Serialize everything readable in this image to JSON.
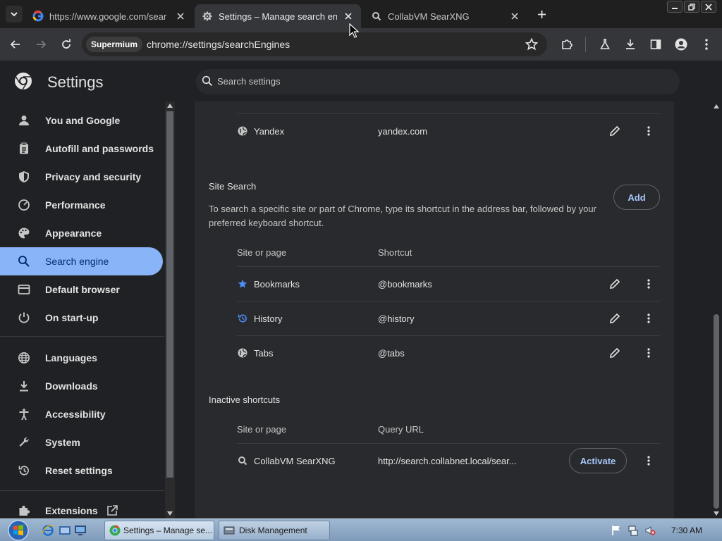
{
  "colors": {
    "accent": "#8ab4f8",
    "link": "#a8c7fa",
    "card": "#292a2d",
    "background": "#202124"
  },
  "tabs": [
    {
      "title": "https://www.google.com/sear",
      "icon": "google-icon",
      "active": false
    },
    {
      "title": "Settings – Manage search engi",
      "icon": "gear-icon",
      "active": true
    },
    {
      "title": "CollabVM SearXNG",
      "icon": "searxng-icon",
      "active": false
    }
  ],
  "toolbar": {
    "profile_chip": "Supermium",
    "url": "chrome://settings/searchEngines"
  },
  "header": {
    "title": "Settings",
    "search_placeholder": "Search settings"
  },
  "sidebar": {
    "items": [
      {
        "label": "You and Google",
        "icon": "person-icon"
      },
      {
        "label": "Autofill and passwords",
        "icon": "clipboard-icon"
      },
      {
        "label": "Privacy and security",
        "icon": "shield-icon"
      },
      {
        "label": "Performance",
        "icon": "gauge-icon"
      },
      {
        "label": "Appearance",
        "icon": "palette-icon"
      },
      {
        "label": "Search engine",
        "icon": "search-icon",
        "selected": true
      },
      {
        "label": "Default browser",
        "icon": "browser-icon"
      },
      {
        "label": "On start-up",
        "icon": "power-icon"
      },
      {
        "label": "Languages",
        "icon": "globe-icon"
      },
      {
        "label": "Downloads",
        "icon": "download-icon"
      },
      {
        "label": "Accessibility",
        "icon": "accessibility-icon"
      },
      {
        "label": "System",
        "icon": "wrench-icon"
      },
      {
        "label": "Reset settings",
        "icon": "reset-icon"
      },
      {
        "label": "Extensions",
        "icon": "puzzle-icon",
        "external": true
      }
    ]
  },
  "engines": [
    {
      "name": "Yandex",
      "shortcut": "yandex.com",
      "icon": "globe-icon"
    }
  ],
  "site_search": {
    "title": "Site Search",
    "description": "To search a specific site or part of Chrome, type its shortcut in the address bar, followed by your preferred keyboard shortcut.",
    "add_label": "Add",
    "col_site": "Site or page",
    "col_shortcut": "Shortcut",
    "rows": [
      {
        "name": "Bookmarks",
        "shortcut": "@bookmarks",
        "icon": "star-icon"
      },
      {
        "name": "History",
        "shortcut": "@history",
        "icon": "history-icon"
      },
      {
        "name": "Tabs",
        "shortcut": "@tabs",
        "icon": "globe-icon"
      }
    ]
  },
  "inactive": {
    "title": "Inactive shortcuts",
    "col_site": "Site or page",
    "col_url": "Query URL",
    "rows": [
      {
        "name": "CollabVM SearXNG",
        "url": "http://search.collabnet.local/sear...",
        "action": "Activate",
        "icon": "searxng-icon"
      }
    ]
  },
  "taskbar": {
    "items": [
      {
        "label": "Settings – Manage se...",
        "active": true
      },
      {
        "label": "Disk Management",
        "active": false
      }
    ],
    "clock": "7:30 AM"
  }
}
